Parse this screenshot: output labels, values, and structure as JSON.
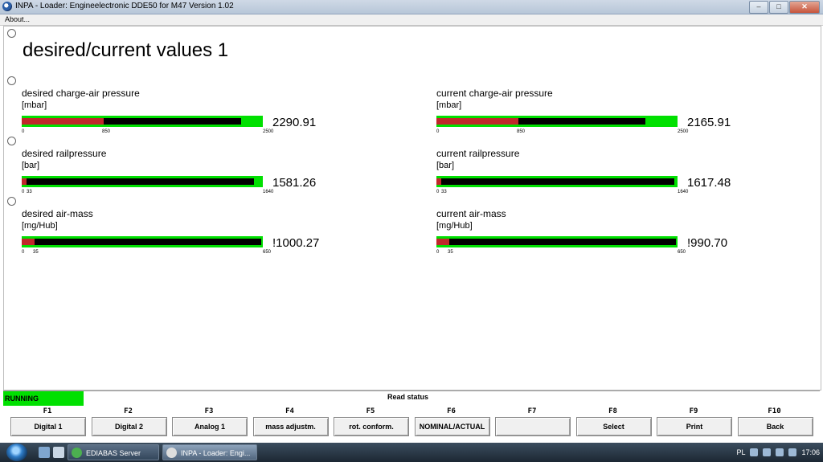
{
  "window": {
    "title": "INPA - Loader:  Engineelectronic DDE50 for M47 Version 1.02"
  },
  "menu": {
    "about": "About..."
  },
  "page": {
    "title": "desired/current values 1"
  },
  "gauges": [
    {
      "label": "desired charge-air pressure",
      "unit": "[mbar]",
      "value_text": "2290.91",
      "min": "0",
      "mid": "850",
      "max": "2500",
      "current_fraction": 0.91,
      "reference_fraction": 0.34
    },
    {
      "label": "current charge-air pressure",
      "unit": "[mbar]",
      "value_text": "2165.91",
      "min": "0",
      "mid": "850",
      "max": "2500",
      "current_fraction": 0.866,
      "reference_fraction": 0.34
    },
    {
      "label": "desired railpressure",
      "unit": "[bar]",
      "value_text": "1581.26",
      "min": "0",
      "mid": "33",
      "max": "1640",
      "current_fraction": 0.964,
      "reference_fraction": 0.02
    },
    {
      "label": "current railpressure",
      "unit": "[bar]",
      "value_text": "1617.48",
      "min": "0",
      "mid": "33",
      "max": "1640",
      "current_fraction": 0.986,
      "reference_fraction": 0.02
    },
    {
      "label": "desired air-mass",
      "unit": "[mg/Hub]",
      "value_text": "!1000.27",
      "min": "0",
      "mid": "35",
      "max": "650",
      "current_fraction": 1.0,
      "reference_fraction": 0.054
    },
    {
      "label": "current air-mass",
      "unit": "[mg/Hub]",
      "value_text": "!990.70",
      "min": "0",
      "mid": "35",
      "max": "650",
      "current_fraction": 1.0,
      "reference_fraction": 0.054
    }
  ],
  "status": {
    "running": "RUNNING",
    "read_status": "Read status"
  },
  "fkeys": [
    {
      "key": "F1",
      "label": "Digital 1"
    },
    {
      "key": "F2",
      "label": "Digital 2"
    },
    {
      "key": "F3",
      "label": "Analog 1"
    },
    {
      "key": "F4",
      "label": "mass adjustm."
    },
    {
      "key": "F5",
      "label": "rot. conform."
    },
    {
      "key": "F6",
      "label": "NOMINAL/ACTUAL"
    },
    {
      "key": "F7",
      "label": ""
    },
    {
      "key": "F8",
      "label": "Select"
    },
    {
      "key": "F9",
      "label": "Print"
    },
    {
      "key": "F10",
      "label": "Back"
    }
  ],
  "taskbar": {
    "tasks": [
      "EDIABAS Server",
      "INPA - Loader:  Engi..."
    ],
    "language": "PL",
    "time": "17:06"
  },
  "colors": {
    "bar_green": "#00e000",
    "bar_current": "#000000",
    "bar_reference": "#c0282a"
  }
}
